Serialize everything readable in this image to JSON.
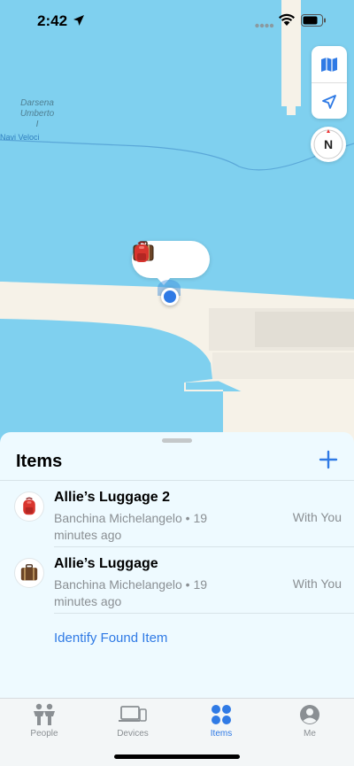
{
  "status_bar": {
    "time": "2:42"
  },
  "map": {
    "labels": [
      "Darsena",
      "Umberto",
      "I"
    ],
    "route_label": "Navi Veloci",
    "compass_letter": "N",
    "colors": {
      "water": "#7fd0ef",
      "land": "#f6f2e8"
    }
  },
  "sheet": {
    "title": "Items",
    "items": [
      {
        "name": "Allie’s Luggage 2",
        "location": "Banchina Michelangelo • 19 minutes ago",
        "status": "With You",
        "icon": "backpack-icon"
      },
      {
        "name": "Allie’s Luggage",
        "location": "Banchina Michelangelo • 19 minutes ago",
        "status": "With You",
        "icon": "suitcase-icon"
      }
    ],
    "identify_label": "Identify Found Item"
  },
  "tabs": [
    {
      "label": "People",
      "icon": "people-icon",
      "active": false
    },
    {
      "label": "Devices",
      "icon": "devices-icon",
      "active": false
    },
    {
      "label": "Items",
      "icon": "items-icon",
      "active": true
    },
    {
      "label": "Me",
      "icon": "me-icon",
      "active": false
    }
  ],
  "accent_color": "#2f7ae5"
}
